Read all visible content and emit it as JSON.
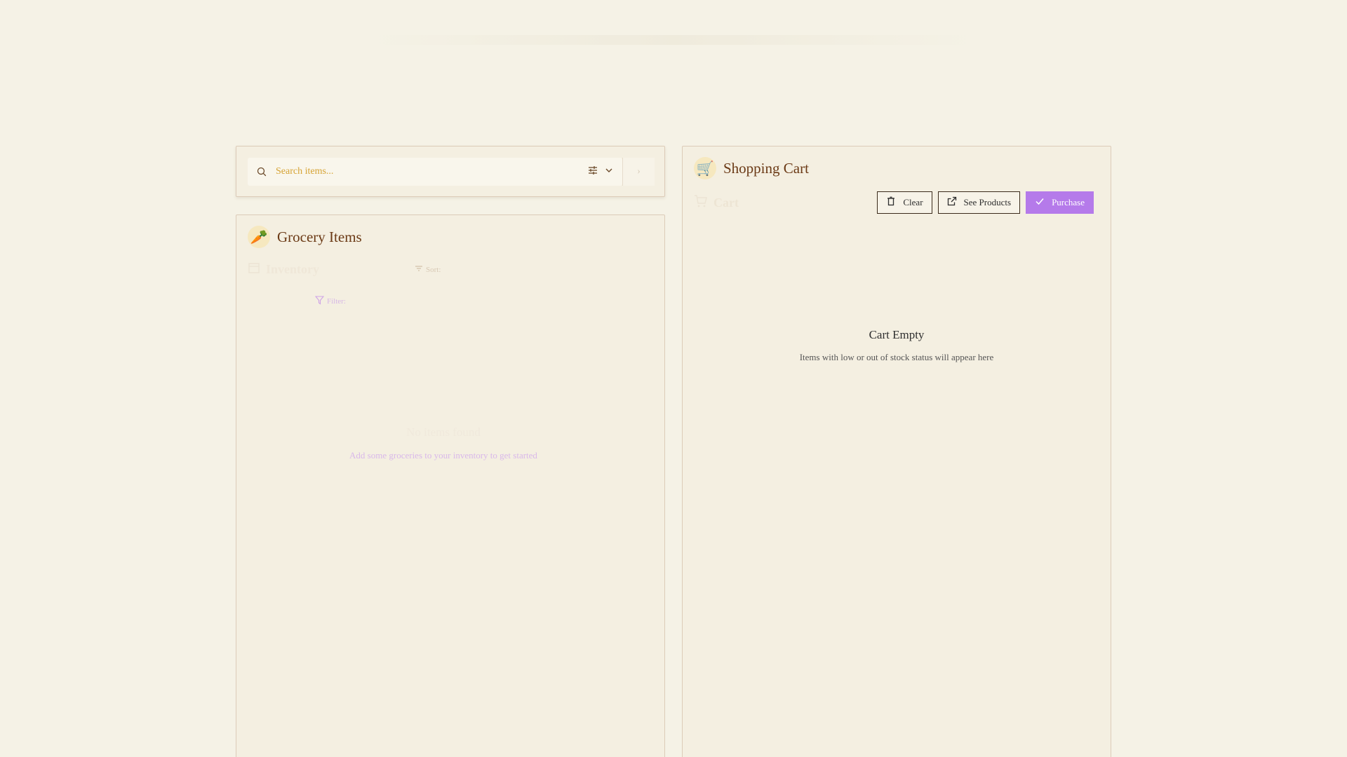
{
  "search": {
    "placeholder": "Search items...",
    "icon": "search-icon",
    "filter_icon": "sliders-icon",
    "chevron_icon": "chevron-down-icon",
    "side_button": "›"
  },
  "grocery": {
    "emoji": "🥕",
    "title": "Grocery Items",
    "inventory_label": "Inventory",
    "sort_label": "Sort:",
    "filter_label": "Filter:",
    "empty_title": "No items found",
    "empty_sub": "Add some groceries to your inventory to get started"
  },
  "cart": {
    "emoji": "🛒",
    "title": "Shopping Cart",
    "sub_label": "Cart",
    "buttons": {
      "clear": "Clear",
      "see_products": "See Products",
      "purchase": "Purchase"
    },
    "empty_title": "Cart Empty",
    "empty_sub": "Items with low or out of stock status will appear here"
  },
  "colors": {
    "background": "#f5f2e6",
    "accent": "#b57aea",
    "title": "#6b3a16",
    "placeholder": "#d6a334"
  }
}
